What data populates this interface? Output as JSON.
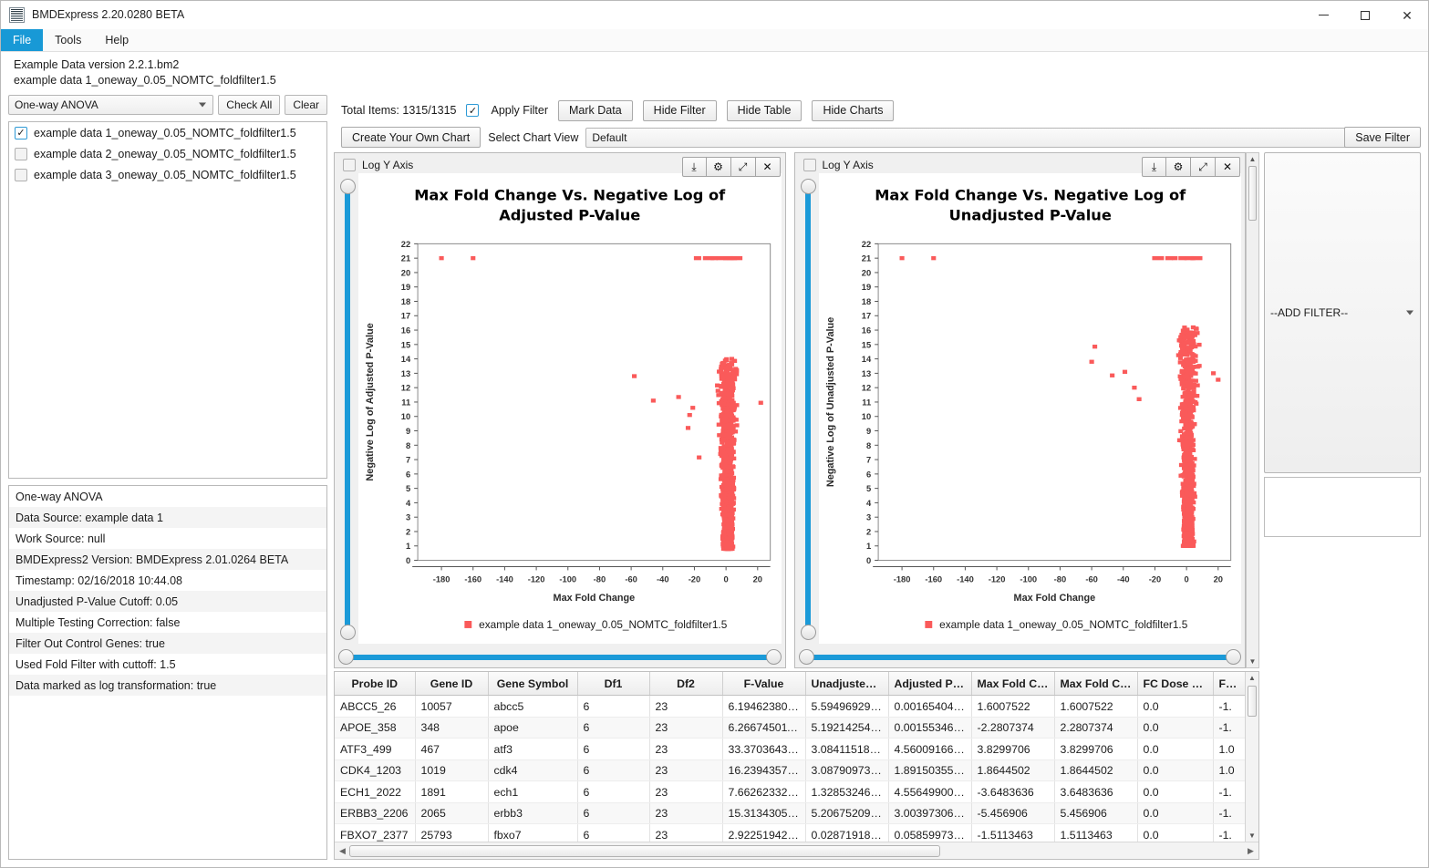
{
  "window": {
    "title": "BMDExpress 2.20.0280 BETA",
    "icon": "bmd-app-icon",
    "minimize": "—",
    "maximize": "□",
    "close": "✕"
  },
  "menubar": {
    "items": [
      "File",
      "Tools",
      "Help"
    ],
    "active": "File"
  },
  "header": {
    "line1": "Example Data version 2.2.1.bm2",
    "line2": "example data 1_oneway_0.05_NOMTC_foldfilter1.5"
  },
  "sidebar": {
    "analysis_select": "One-way ANOVA",
    "check_all_label": "Check All",
    "clear_label": "Clear",
    "datasets": [
      {
        "label": "example data 1_oneway_0.05_NOMTC_foldfilter1.5",
        "checked": true
      },
      {
        "label": "example data 2_oneway_0.05_NOMTC_foldfilter1.5",
        "checked": false
      },
      {
        "label": "example data 3_oneway_0.05_NOMTC_foldfilter1.5",
        "checked": false
      }
    ],
    "info_rows": [
      "One-way ANOVA",
      "Data Source: example data 1",
      "Work Source: null",
      "BMDExpress2 Version: BMDExpress 2.01.0264 BETA",
      "Timestamp: 02/16/2018 10:44.08",
      "Unadjusted P-Value Cutoff: 0.05",
      "Multiple Testing Correction: false",
      "Filter Out Control Genes: true",
      "Used Fold Filter with cuttoff: 1.5",
      "Data marked as log transformation: true"
    ]
  },
  "toolbar": {
    "total_items": "Total Items: 1315/1315",
    "apply_filter_label": "Apply Filter",
    "apply_filter_checked": true,
    "mark_data": "Mark Data",
    "hide_filter": "Hide Filter",
    "hide_table": "Hide Table",
    "hide_charts": "Hide Charts",
    "create_chart": "Create Your Own Chart",
    "select_chart_view_label": "Select Chart View",
    "select_chart_view_value": "Default"
  },
  "filter_pane": {
    "save_filter": "Save Filter",
    "add_filter": "--ADD FILTER--"
  },
  "charts": {
    "log_y_label": "Log Y Axis",
    "tools": {
      "download": "⤓",
      "settings": "⚙",
      "expand": "⤢",
      "close": "✕"
    }
  },
  "chart_data": [
    {
      "type": "scatter",
      "title": "Max Fold Change Vs. Negative Log of Adjusted P-Value",
      "xlabel": "Max Fold Change",
      "ylabel": "Negative Log of Adjusted P-Value",
      "legend": "example data 1_oneway_0.05_NOMTC_foldfilter1.5",
      "legend_position": "bottom",
      "marker_color": "#FA5A5A",
      "grid": false,
      "xlim": [
        -195,
        28
      ],
      "ylim": [
        0,
        22
      ],
      "xticks": [
        -180,
        -160,
        -140,
        -120,
        -100,
        -80,
        -60,
        -40,
        -20,
        0,
        20
      ],
      "yticks": [
        0,
        1,
        2,
        3,
        4,
        5,
        6,
        7,
        8,
        9,
        10,
        11,
        12,
        13,
        14,
        15,
        16,
        17,
        18,
        19,
        20,
        21,
        22
      ],
      "n_points": 1315,
      "outliers_top": [
        {
          "x": -180,
          "y": 21
        },
        {
          "x": -160,
          "y": 21
        },
        {
          "x": -18,
          "y": 21
        },
        {
          "x": -11,
          "y": 21
        },
        {
          "x": -7.5,
          "y": 21
        },
        {
          "x": -2.5,
          "y": 21
        },
        {
          "x": 1.5,
          "y": 21
        },
        {
          "x": 4,
          "y": 21
        },
        {
          "x": 6.5,
          "y": 21
        }
      ],
      "outliers_mid": [
        {
          "x": -58,
          "y": 12.8
        },
        {
          "x": -46,
          "y": 11.1
        },
        {
          "x": -30,
          "y": 11.35
        },
        {
          "x": -21,
          "y": 10.6
        },
        {
          "x": -23,
          "y": 10.1
        },
        {
          "x": -24,
          "y": 9.2
        },
        {
          "x": -17,
          "y": 7.15
        },
        {
          "x": 22,
          "y": 10.95
        }
      ],
      "cluster": {
        "x_center": 1.0,
        "x_spread": 6.0,
        "y_min": 0.8,
        "y_max": 14.0
      }
    },
    {
      "type": "scatter",
      "title": "Max Fold Change Vs. Negative Log of Unadjusted P-Value",
      "xlabel": "Max Fold Change",
      "ylabel": "Negative Log of Unadjusted P-Value",
      "legend": "example data 1_oneway_0.05_NOMTC_foldfilter1.5",
      "legend_position": "bottom",
      "marker_color": "#FA5A5A",
      "grid": false,
      "xlim": [
        -195,
        28
      ],
      "ylim": [
        0,
        22
      ],
      "xticks": [
        -180,
        -160,
        -140,
        -120,
        -100,
        -80,
        -60,
        -40,
        -20,
        0,
        20
      ],
      "yticks": [
        0,
        1,
        2,
        3,
        4,
        5,
        6,
        7,
        8,
        9,
        10,
        11,
        12,
        13,
        14,
        15,
        16,
        17,
        18,
        19,
        20,
        21,
        22
      ],
      "n_points": 1315,
      "outliers_top": [
        {
          "x": -180,
          "y": 21
        },
        {
          "x": -160,
          "y": 21
        },
        {
          "x": -18,
          "y": 21
        },
        {
          "x": -11,
          "y": 21
        },
        {
          "x": -7.5,
          "y": 21
        },
        {
          "x": -2.5,
          "y": 21
        },
        {
          "x": 1.5,
          "y": 21
        },
        {
          "x": 4,
          "y": 21
        },
        {
          "x": 6.5,
          "y": 21
        }
      ],
      "outliers_mid": [
        {
          "x": -58,
          "y": 14.85
        },
        {
          "x": -47,
          "y": 12.85
        },
        {
          "x": -39,
          "y": 13.1
        },
        {
          "x": -33,
          "y": 12.0
        },
        {
          "x": -30,
          "y": 11.2
        },
        {
          "x": -60,
          "y": 13.8
        },
        {
          "x": 20,
          "y": 12.55
        },
        {
          "x": 17,
          "y": 13.0
        }
      ],
      "cluster": {
        "x_center": 1.0,
        "x_spread": 6.0,
        "y_min": 1.0,
        "y_max": 16.2
      }
    }
  ],
  "table": {
    "columns": [
      "Probe ID",
      "Gene ID",
      "Gene Symbol",
      "Df1",
      "Df2",
      "F-Value",
      "Unadjusted ...",
      "Adjusted P-V...",
      "Max Fold Ch...",
      "Max Fold Ch...",
      "FC Dose Leve...",
      "FC D"
    ],
    "rows": [
      [
        "ABCC5_26",
        "10057",
        "abcc5",
        "6",
        "23",
        "6.1946238035...",
        "5.5949692958...",
        "0.0016540440...",
        "1.6007522",
        "1.6007522",
        "0.0",
        "-1."
      ],
      [
        "APOE_358",
        "348",
        "apoe",
        "6",
        "23",
        "6.2667450117...",
        "5.1921425482...",
        "0.0015534681...",
        "-2.2807374",
        "2.2807374",
        "0.0",
        "-1."
      ],
      [
        "ATF3_499",
        "467",
        "atf3",
        "6",
        "23",
        "33.370364336...",
        "3.0841151854...",
        "4.5600916667...",
        "3.8299706",
        "3.8299706",
        "0.0",
        "1.0"
      ],
      [
        "CDK4_1203",
        "1019",
        "cdk4",
        "6",
        "23",
        "16.239435795...",
        "3.0879097334...",
        "1.8915035548...",
        "1.8644502",
        "1.8644502",
        "0.0",
        "1.0"
      ],
      [
        "ECH1_2022",
        "1891",
        "ech1",
        "6",
        "23",
        "7.6626233299...",
        "1.3285324603...",
        "4.5564990029...",
        "-3.6483636",
        "3.6483636",
        "0.0",
        "-1."
      ],
      [
        "ERBB3_2206",
        "2065",
        "erbb3",
        "6",
        "23",
        "15.313430580...",
        "5.2067520994...",
        "3.0039730620...",
        "-5.456906",
        "5.456906",
        "0.0",
        "-1."
      ],
      [
        "FBXO7_2377",
        "25793",
        "fbxo7",
        "6",
        "23",
        "2.9225194282...",
        "0.0287191825...",
        "0.0585997303...",
        "-1.5113463",
        "1.5113463",
        "0.0",
        "-1."
      ]
    ]
  }
}
